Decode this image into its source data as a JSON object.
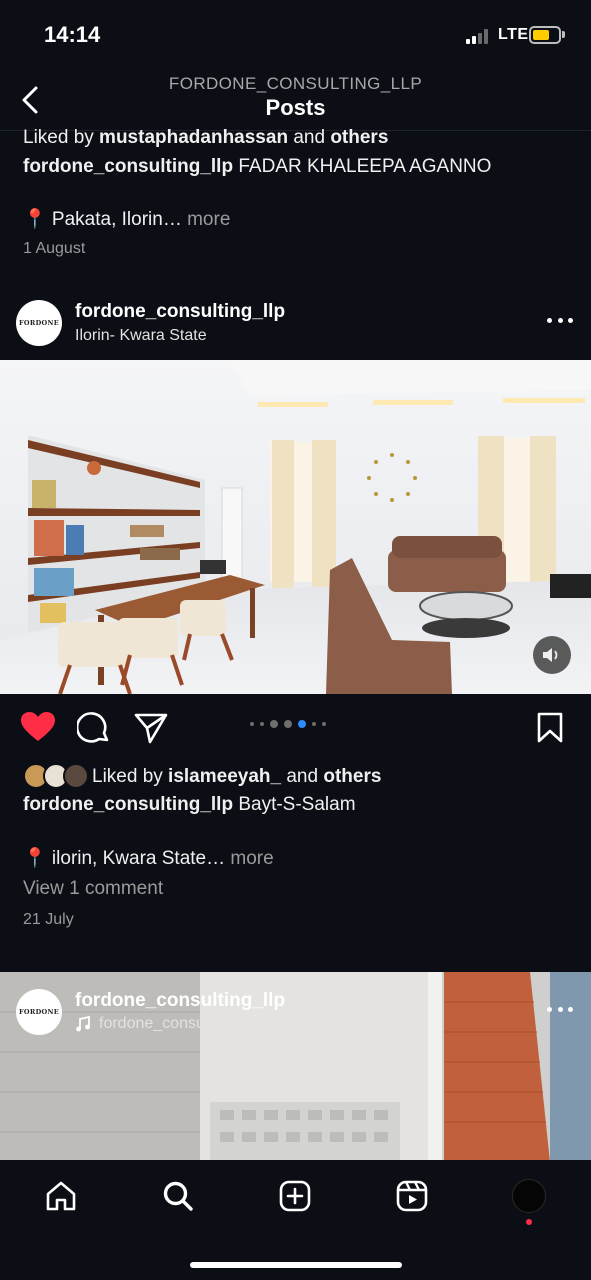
{
  "status_bar": {
    "time": "14:14",
    "network": "LTE"
  },
  "header": {
    "account": "FORDONE_CONSULTING_LLP",
    "title": "Posts"
  },
  "prev_post": {
    "liked_prefix": "Liked by ",
    "liked_user": "mustaphadanhassan",
    "liked_suffix": " and ",
    "liked_others": "others",
    "caption_user": "fordone_consulting_llp",
    "caption_text": " FADAR KHALEEPA AGANNO",
    "location": "📍 Pakata, Ilorin…",
    "more": " more",
    "date": "1 August"
  },
  "post": {
    "avatar_text": "FORDONE",
    "username": "fordone_consulting_llp",
    "location": "Ilorin- Kwara State",
    "liked_prefix": "Liked by ",
    "liked_user": "islameeyah_",
    "liked_suffix": " and ",
    "liked_others": "others",
    "caption_user": "fordone_consulting_llp",
    "caption_text": " Bayt-S-Salam",
    "caption_location": "📍 ilorin, Kwara State…",
    "more": " more",
    "comments": "View 1 comment",
    "date": "21 July",
    "liked": true,
    "carousel_active_index": 4,
    "carousel_count": 7
  },
  "next_post": {
    "avatar_text": "FORDONE",
    "username": "fordone_consulting_llp",
    "audio": "fordone_consulting_llp · Original audio"
  },
  "icons": {
    "back": "chevron-left-icon",
    "more": "more-dots-icon",
    "like": "heart-icon",
    "comment": "comment-icon",
    "share": "send-icon",
    "save": "bookmark-icon",
    "mute": "speaker-icon",
    "home": "home-icon",
    "search": "search-icon",
    "create": "plus-square-icon",
    "reels": "reels-icon"
  },
  "colors": {
    "background": "#0b0e14",
    "like": "#ff2d45",
    "carousel_active": "#2e8cff",
    "battery": "#ffcc00"
  }
}
